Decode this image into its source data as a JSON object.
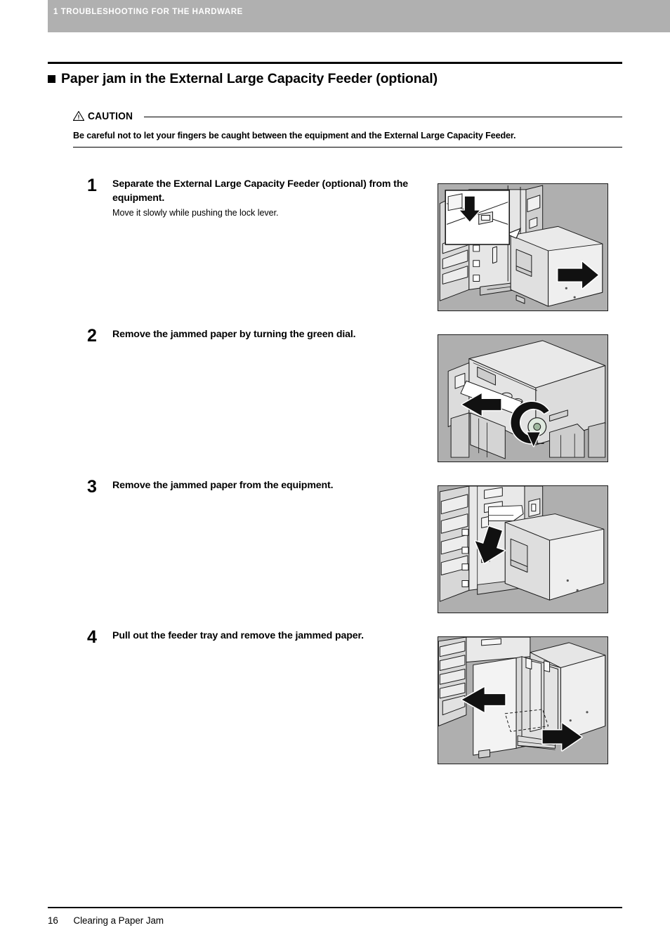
{
  "header": {
    "running_head": "1 TROUBLESHOOTING FOR THE HARDWARE",
    "bar_color": "#b0b0b0",
    "text_color": "#ffffff"
  },
  "section": {
    "bullet": "filled-square",
    "title": "Paper jam in the External Large Capacity Feeder (optional)"
  },
  "caution": {
    "icon": "warning-triangle-icon",
    "label": "CAUTION",
    "text": "Be careful not to let your fingers be caught between the equipment and the External Large Capacity Feeder."
  },
  "steps": [
    {
      "number": "1",
      "title": "Separate the External Large Capacity Feeder (optional) from the equipment.",
      "subtext": "Move it slowly while pushing the lock lever.",
      "figure": {
        "name": "figure-separate-feeder",
        "alt": "Copier with external large capacity feeder being moved away to the right; inset callout shows the lock lever pressed downward",
        "background": "#afafaf"
      }
    },
    {
      "number": "2",
      "title": "Remove the jammed paper by turning the green dial.",
      "subtext": "",
      "figure": {
        "name": "figure-green-dial",
        "alt": "Top view of the equipment: jammed sheet pulled out to the left while the green dial is rotated",
        "background": "#afafaf"
      }
    },
    {
      "number": "3",
      "title": "Remove the jammed paper from the equipment.",
      "subtext": "",
      "figure": {
        "name": "figure-remove-from-equipment",
        "alt": "Jammed sheet protruding from the equipment side with a large arrow pointing down and to the right",
        "background": "#afafaf"
      }
    },
    {
      "number": "4",
      "title": "Pull out the feeder tray and remove the jammed paper.",
      "subtext": "",
      "figure": {
        "name": "figure-pull-feeder-tray",
        "alt": "Feeder tray pulled out from the external large capacity feeder with two arrows indicating the pull direction",
        "background": "#afafaf"
      }
    }
  ],
  "footer": {
    "page_number": "16",
    "section_label": "Clearing a Paper Jam"
  }
}
